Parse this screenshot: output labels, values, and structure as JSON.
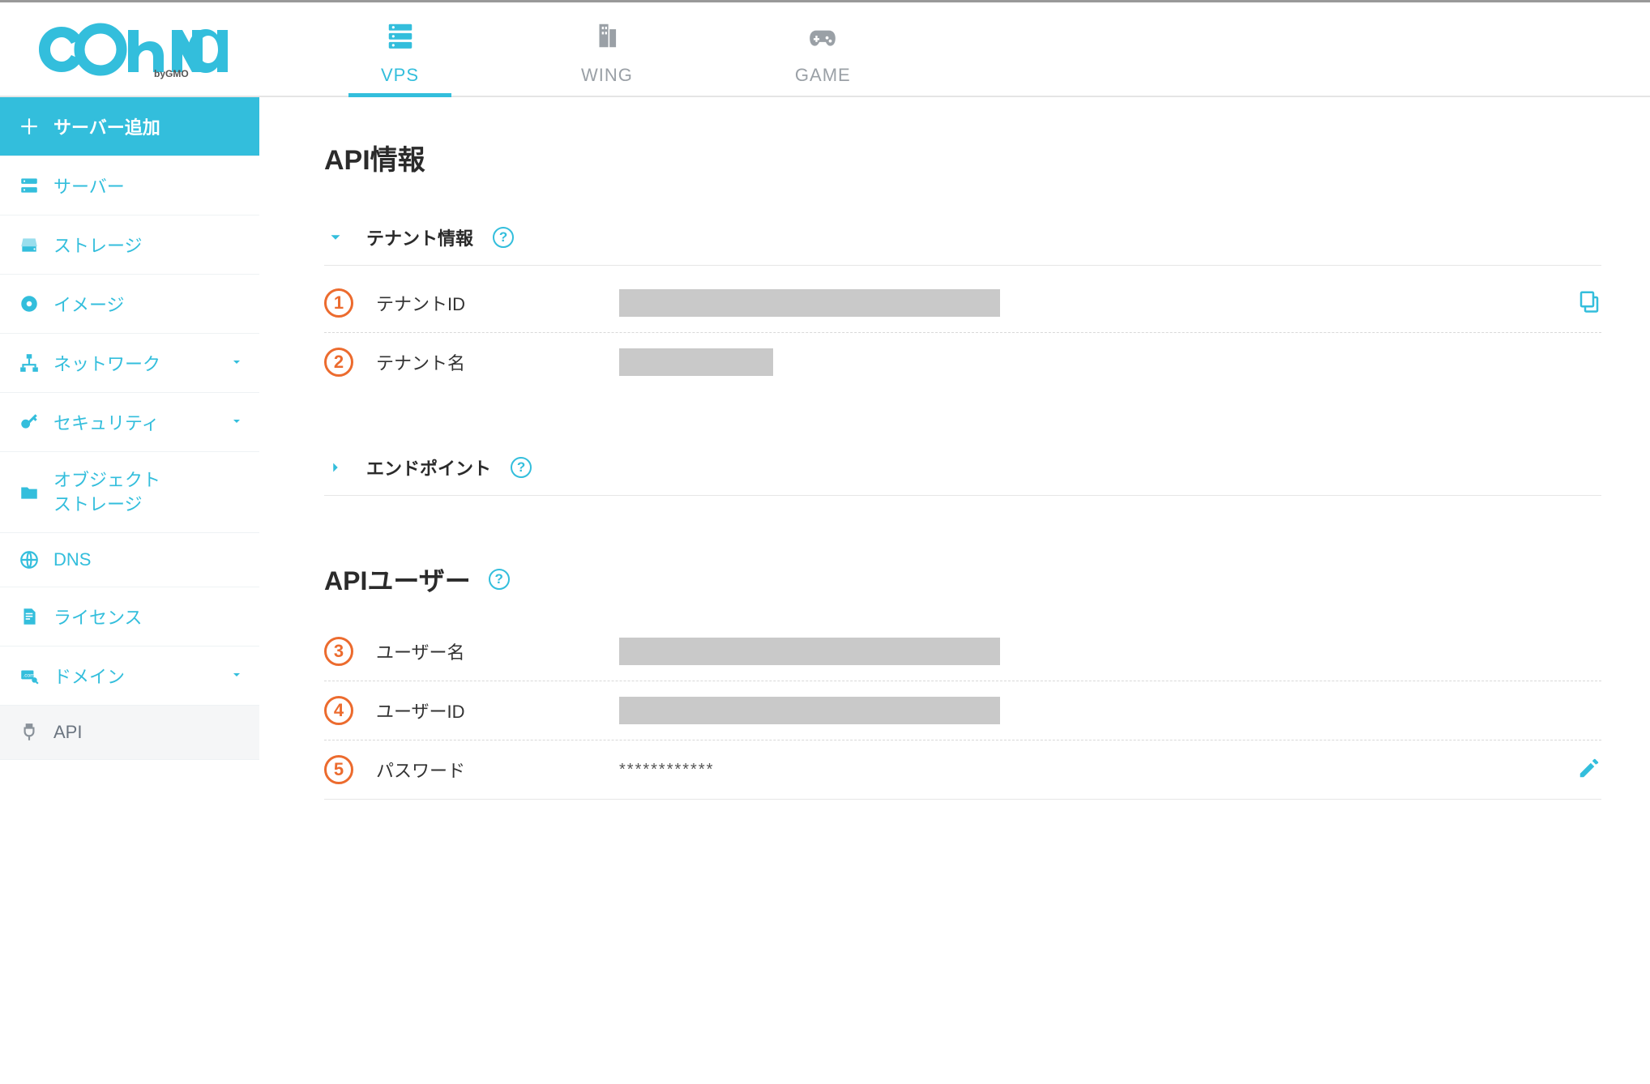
{
  "brand": {
    "name": "ConoHa",
    "by": "byGMO"
  },
  "tabs": {
    "vps": "VPS",
    "wing": "WING",
    "game": "GAME"
  },
  "sidebar": {
    "add_server": "サーバー追加",
    "server": "サーバー",
    "storage": "ストレージ",
    "image": "イメージ",
    "network": "ネットワーク",
    "security": "セキュリティ",
    "object_storage_1": "オブジェクト",
    "object_storage_2": "ストレージ",
    "dns": "DNS",
    "license": "ライセンス",
    "domain": "ドメイン",
    "api": "API"
  },
  "page": {
    "title": "API情報",
    "tenant_section": "テナント情報",
    "endpoint_section": "エンドポイント",
    "api_user_section": "APIユーザー"
  },
  "rows": {
    "tenant_id": {
      "num": "1",
      "label": "テナントID"
    },
    "tenant_name": {
      "num": "2",
      "label": "テナント名"
    },
    "user_name": {
      "num": "3",
      "label": "ユーザー名"
    },
    "user_id": {
      "num": "4",
      "label": "ユーザーID"
    },
    "password": {
      "num": "5",
      "label": "パスワード",
      "value": "************"
    }
  }
}
